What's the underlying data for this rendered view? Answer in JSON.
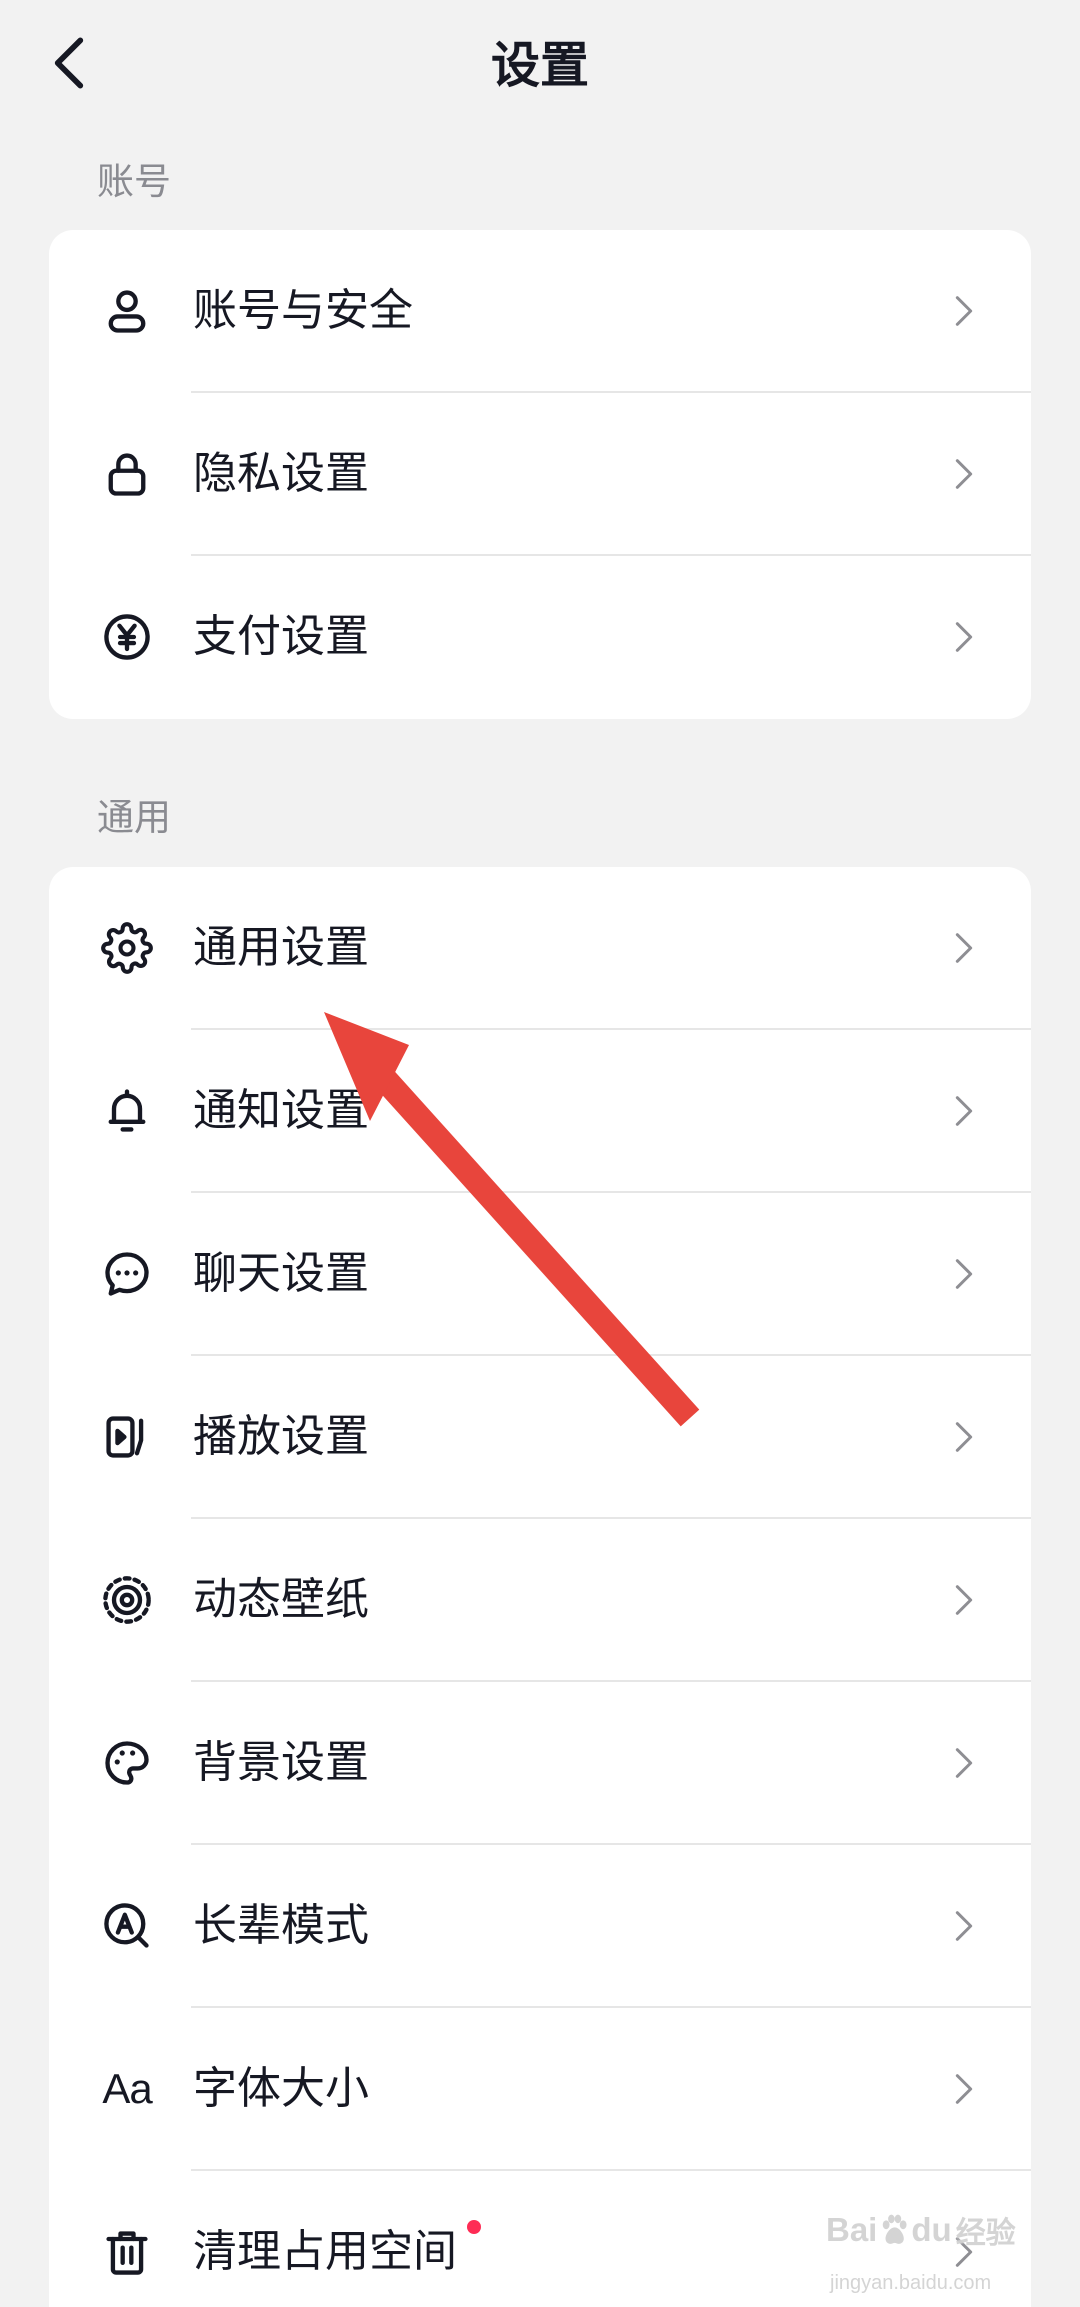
{
  "header": {
    "title": "设置",
    "back_icon": "chevron-left-icon"
  },
  "sections": [
    {
      "label": "账号",
      "items": [
        {
          "label": "账号与安全",
          "icon": "user-icon"
        },
        {
          "label": "隐私设置",
          "icon": "lock-icon"
        },
        {
          "label": "支付设置",
          "icon": "yen-circle-icon"
        }
      ]
    },
    {
      "label": "通用",
      "items": [
        {
          "label": "通用设置",
          "icon": "gear-icon"
        },
        {
          "label": "通知设置",
          "icon": "bell-icon"
        },
        {
          "label": "聊天设置",
          "icon": "chat-bubble-icon"
        },
        {
          "label": "播放设置",
          "icon": "play-panel-icon"
        },
        {
          "label": "动态壁纸",
          "icon": "live-wallpaper-icon"
        },
        {
          "label": "背景设置",
          "icon": "palette-icon"
        },
        {
          "label": "长辈模式",
          "icon": "elder-mode-icon"
        },
        {
          "label": "字体大小",
          "icon": "font-size-icon",
          "icon_text": "Aa"
        },
        {
          "label": "清理占用空间",
          "icon": "trash-icon",
          "badge": "red-dot"
        }
      ]
    }
  ],
  "row_chevron_icon": "chevron-right-icon",
  "annotation": {
    "icon": "red-arrow"
  },
  "watermark": {
    "brand_left": "Bai",
    "brand_icon": "paw-icon",
    "brand_right": "du",
    "brand_cn": "经验",
    "url": "jingyan.baidu.com"
  },
  "colors": {
    "bg": "#f2f2f2",
    "card": "#ffffff",
    "text": "#161823",
    "section_label": "#8a8b91",
    "divider": "#e6e6e6",
    "chevron": "#8e8e93",
    "badge": "#fe2c55",
    "annotation": "#e8453c"
  }
}
